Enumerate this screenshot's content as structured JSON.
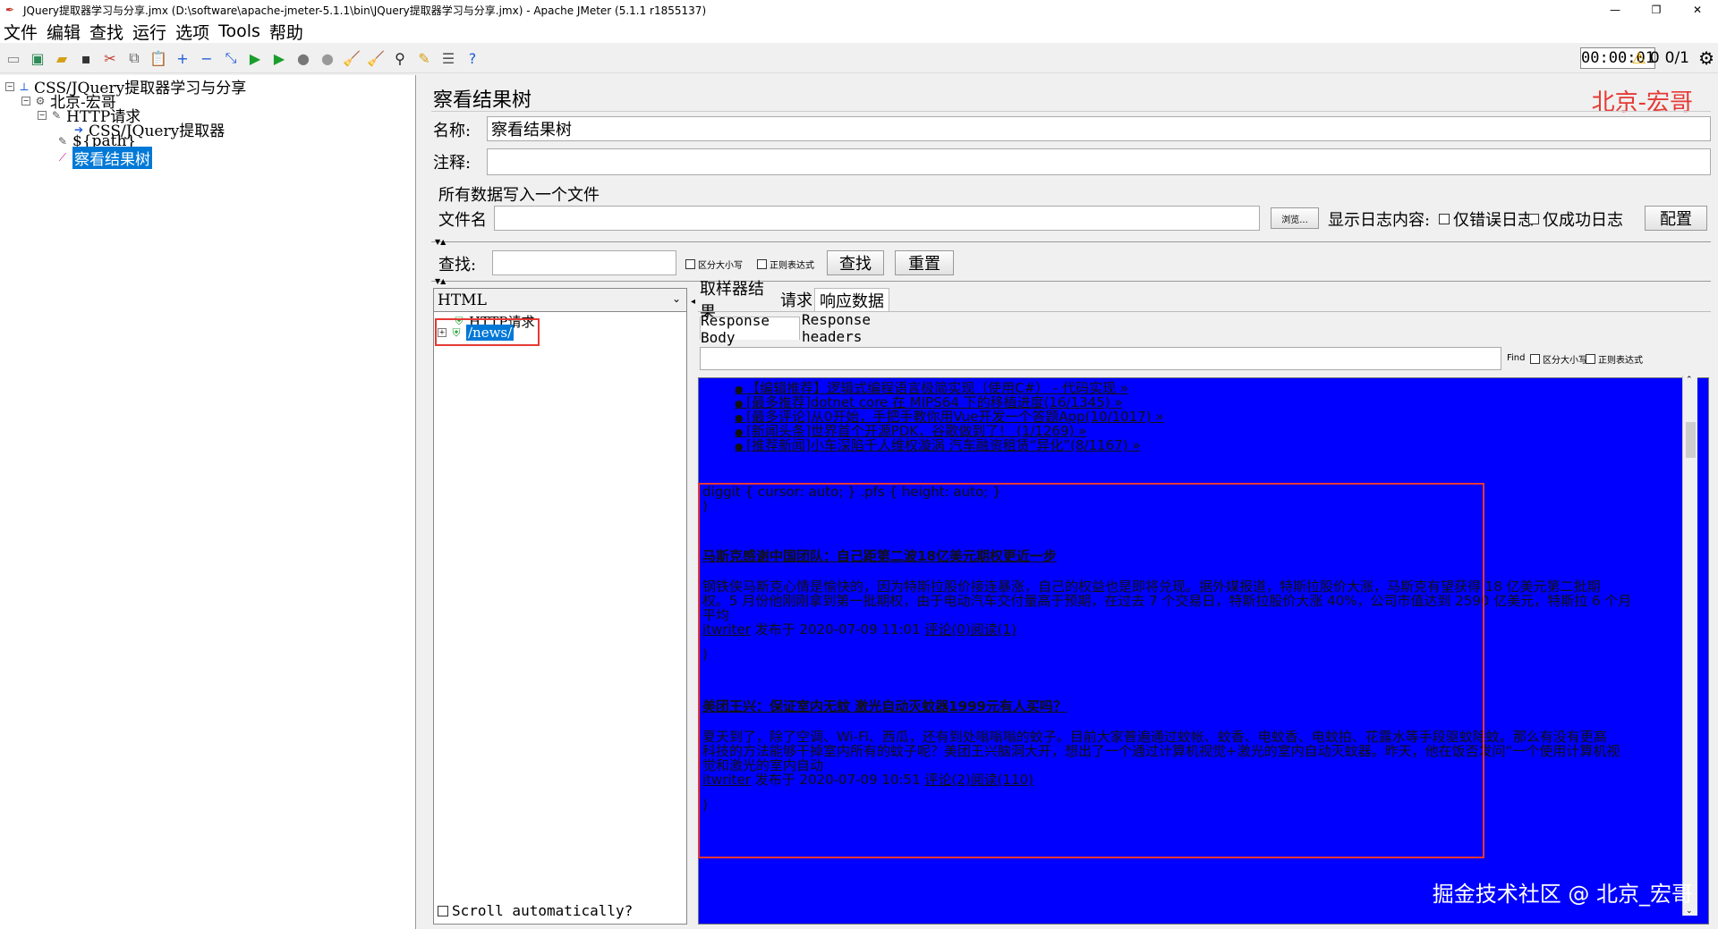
{
  "window": {
    "title": "JQuery提取器学习与分享.jmx (D:\\software\\apache-jmeter-5.1.1\\bin\\JQuery提取器学习与分享.jmx) - Apache JMeter (5.1.1 r1855137)",
    "minimize": "—",
    "maximize": "❐",
    "close": "✕"
  },
  "menu": [
    "文件",
    "编辑",
    "查找",
    "运行",
    "选项",
    "Tools",
    "帮助"
  ],
  "status": {
    "timer": "00:00:01",
    "warnings": "0",
    "threads": "0/1"
  },
  "tree": {
    "root": "CSS/JQuery提取器学习与分享",
    "group": "北京-宏哥",
    "http": "HTTP请求",
    "extractor": "CSS/JQuery提取器",
    "path": "${path}",
    "listener": "察看结果树"
  },
  "panel": {
    "title": "察看结果树",
    "watermark": "北京-宏哥",
    "name_label": "名称:",
    "name_value": "察看结果树",
    "comment_label": "注释:",
    "comment_value": "",
    "write_all": "所有数据写入一个文件",
    "filename_label": "文件名",
    "filename_value": "",
    "browse": "浏览...",
    "log_label": "显示日志内容:",
    "errors_only": "仅错误日志",
    "success_only": "仅成功日志",
    "configure": "配置",
    "search_label": "查找:",
    "search_value": "",
    "case_sensitive": "区分大小写",
    "regex": "正则表达式",
    "find_button": "查找",
    "reset_button": "重置"
  },
  "results": {
    "renderer": "HTML",
    "sample_http": "HTTP请求",
    "sample_news": "/news/",
    "scroll_auto": "Scroll automatically?",
    "tabs": [
      "取样器结果",
      "请求",
      "响应数据"
    ],
    "subtabs": [
      "Response Body",
      "Response headers"
    ],
    "find_label": "Find",
    "find_case": "区分大小写",
    "find_regex": "正则表达式"
  },
  "html_content": {
    "links": [
      "【编辑推荐】逻辑式编程语言极简实现（使用C#） - 代码实现 »",
      "[最多推荐]dotnet core 在 MIPS64 下的移植进度(16/1345) »",
      "[最多评论]从0开始，手把手教你用Vue开发一个答题App(10/1017) »",
      "[新闻头条]世界首个开源PDK，谷歌做到了！ (1/1269) »",
      "[推荐新闻]小车深陷千人维权漩涡 汽车融资租赁“异化”(8/1167) »"
    ],
    "css_line": "diggit { cursor: auto; } .pfs { height: auto; }",
    "paren1": ")",
    "news1_title": "马斯克感谢中国团队：自己距第二波18亿美元期权更近一步",
    "news1_body1": "钢铁侠马斯克心情是愉快的，因为特斯拉股价接连暴涨，自己的权益也是即将兑现。据外媒报道，特斯拉股价大涨，马斯克有望获得 18 亿美元第二批期",
    "news1_body2": "权。5 月份他刚刚拿到第一批期权，由于电动汽车交付量高于预期，在过去 7 个交易日，特斯拉股价大涨 40%，公司市值达到 2590 亿美元，特斯拉 6 个月",
    "news1_body3": "平均",
    "news1_author": "itwriter",
    "news1_meta": " 发布于 2020-07-09 11:01 ",
    "news1_comments": "评论(0)",
    "news1_reads": "阅读(1)",
    "paren2": ")",
    "news2_title": "美团王兴：保证室内无蚊 激光自动灭蚊器1999元有人买吗？",
    "news2_body1": "夏天到了，除了空调、Wi-Fi、西瓜，还有到处嗡嗡嗡的蚊子。目前大家普遍通过蚊帐、蚊香、电蚊香、电蚊拍、花露水等手段驱蚊除蚊。那么有没有更高",
    "news2_body2": "科技的方法能够干掉室内所有的蚊子呢？美团王兴脑洞大开，想出了一个通过计算机视觉+激光的室内自动灭蚊器。昨天，他在饭否发问“一个使用计算机视",
    "news2_body3": "觉和激光的室内自动",
    "news2_author": "itwriter",
    "news2_meta": " 发布于 2020-07-09 10:51 ",
    "news2_comments": "评论(2)",
    "news2_reads": "阅读(110)",
    "paren3": ")"
  },
  "footer_watermark": "掘金技术社区 @ 北京_宏哥"
}
